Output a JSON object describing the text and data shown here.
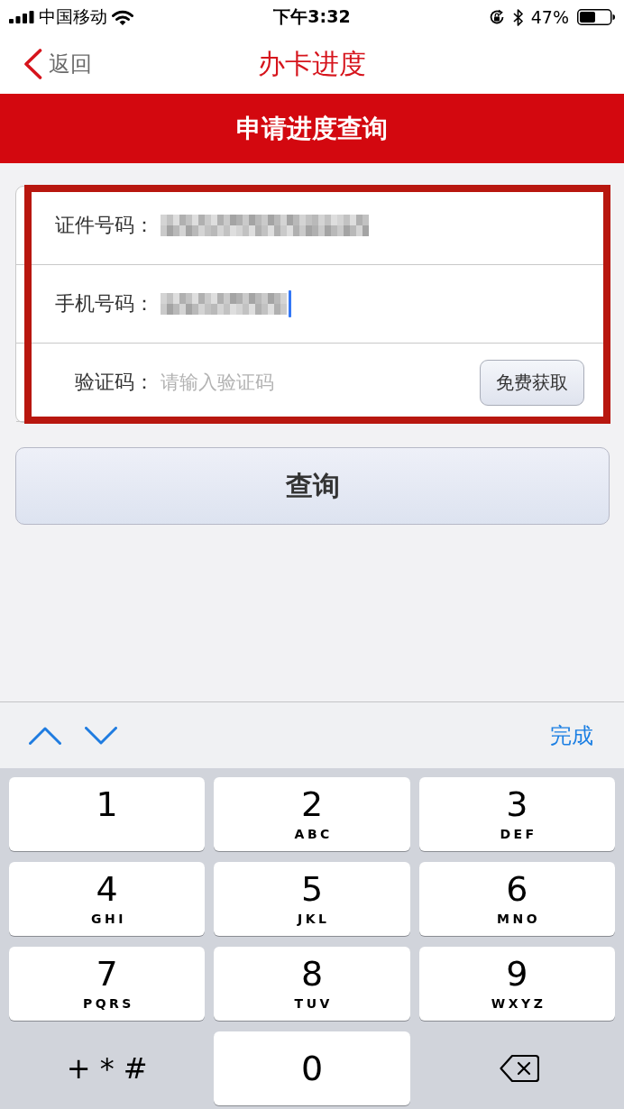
{
  "status_bar": {
    "carrier": "中国移动",
    "time": "下午3:32",
    "battery": "47%"
  },
  "nav_bar": {
    "back_label": "返回",
    "title": "办卡进度"
  },
  "banner": {
    "title": "申请进度查询"
  },
  "form": {
    "highlighted": true,
    "fields": [
      {
        "kind": "id_number",
        "label": "证件号码：",
        "focused": false
      },
      {
        "kind": "phone",
        "label": "手机号码：",
        "focused": true
      },
      {
        "kind": "code",
        "label": "验证码：",
        "placeholder": "请输入验证码",
        "button": "免费获取",
        "focused": false
      }
    ]
  },
  "query_button": {
    "label": "查询"
  },
  "keyboard_toolbar": {
    "done_label": "完成"
  },
  "keypad": {
    "rows": [
      [
        {
          "kind": "digit",
          "digit": "1"
        },
        {
          "kind": "digit",
          "digit": "2",
          "letters": "ABC"
        },
        {
          "kind": "digit",
          "digit": "3",
          "letters": "DEF"
        }
      ],
      [
        {
          "kind": "digit",
          "digit": "4",
          "letters": "GHI"
        },
        {
          "kind": "digit",
          "digit": "5",
          "letters": "JKL"
        },
        {
          "kind": "digit",
          "digit": "6",
          "letters": "MNO"
        }
      ],
      [
        {
          "kind": "digit",
          "digit": "7",
          "letters": "PQRS"
        },
        {
          "kind": "digit",
          "digit": "8",
          "letters": "TUV"
        },
        {
          "kind": "digit",
          "digit": "9",
          "letters": "WXYZ"
        }
      ],
      [
        {
          "kind": "symbols",
          "label": "+*#"
        },
        {
          "kind": "digit",
          "digit": "0"
        },
        {
          "kind": "backspace"
        }
      ]
    ]
  }
}
